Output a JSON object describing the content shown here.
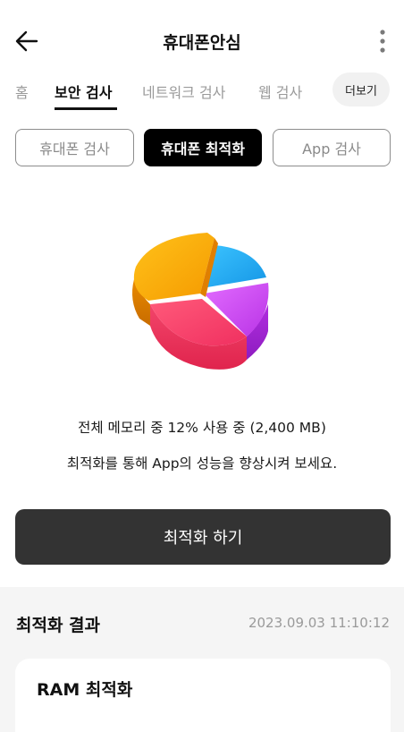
{
  "header": {
    "title": "휴대폰안심",
    "back_icon": "back-arrow-icon",
    "more_icon": "kebab-menu-icon"
  },
  "tabs": [
    {
      "label": "홈",
      "active": false
    },
    {
      "label": "보안 검사",
      "active": true
    },
    {
      "label": "네트워크 검사",
      "active": false
    },
    {
      "label": "웹 검사",
      "active": false
    }
  ],
  "more_chip": "더보기",
  "segments": [
    {
      "label": "휴대폰 검사",
      "active": false
    },
    {
      "label": "휴대폰 최적화",
      "active": true
    },
    {
      "label": "App 검사",
      "active": false
    }
  ],
  "illustration": {
    "icon": "pie-chart-3d-icon",
    "colors": [
      "#f7a900",
      "#f2426a",
      "#c43ee0",
      "#1fa6ee"
    ]
  },
  "memory": {
    "summary": "전체 메모리 중 12% 사용 중 (2,400 MB)",
    "hint": "최적화를 통해 App의 성능을 향상시켜 보세요."
  },
  "action": {
    "optimize_label": "최적화 하기"
  },
  "results": {
    "title": "최적화 결과",
    "timestamp": "2023.09.03 11:10:12",
    "card_title": "RAM 최적화"
  },
  "colors": {
    "primary_button": "#333333",
    "active_segment": "#000000",
    "inactive_text": "#9a9a9a",
    "section_bg": "#f5f5f5"
  }
}
